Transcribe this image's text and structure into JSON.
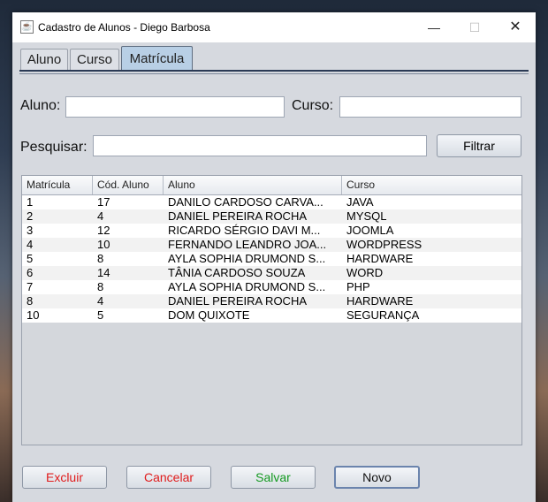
{
  "window": {
    "title": "Cadastro de Alunos - Diego Barbosa",
    "min_glyph": "—",
    "max_glyph": "☐",
    "close_glyph": "✕"
  },
  "tabs": [
    {
      "label": "Aluno"
    },
    {
      "label": "Curso"
    },
    {
      "label": "Matrícula",
      "selected": true
    }
  ],
  "form": {
    "aluno_label": "Aluno:",
    "aluno_value": "",
    "curso_label": "Curso:",
    "curso_value": "",
    "pesquisar_label": "Pesquisar:",
    "pesquisar_value": "",
    "filtrar_label": "Filtrar"
  },
  "table": {
    "columns": [
      "Matrícula",
      "Cód. Aluno",
      "Aluno",
      "Curso"
    ],
    "rows": [
      [
        "1",
        "17",
        "DANILO CARDOSO CARVA...",
        "JAVA"
      ],
      [
        "2",
        "4",
        "DANIEL PEREIRA ROCHA",
        "MYSQL"
      ],
      [
        "3",
        "12",
        "RICARDO SÉRGIO DAVI M...",
        "JOOMLA"
      ],
      [
        "4",
        "10",
        "FERNANDO LEANDRO JOA...",
        "WORDPRESS"
      ],
      [
        "5",
        "8",
        "AYLA SOPHIA DRUMOND S...",
        "HARDWARE"
      ],
      [
        "6",
        "14",
        "TÂNIA CARDOSO SOUZA",
        "WORD"
      ],
      [
        "7",
        "8",
        "AYLA SOPHIA DRUMOND S...",
        "PHP"
      ],
      [
        "8",
        "4",
        "DANIEL PEREIRA ROCHA",
        "HARDWARE"
      ],
      [
        "10",
        "5",
        "DOM QUIXOTE",
        "SEGURANÇA"
      ]
    ]
  },
  "buttons": {
    "excluir": {
      "label": "Excluir",
      "color": "#e01b1b"
    },
    "cancelar": {
      "label": "Cancelar",
      "color": "#e01b1b"
    },
    "salvar": {
      "label": "Salvar",
      "color": "#159a22"
    },
    "novo": {
      "label": "Novo",
      "color": "#111111"
    }
  }
}
